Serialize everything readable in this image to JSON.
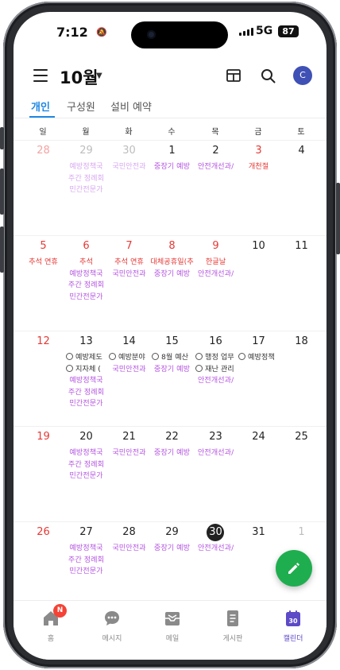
{
  "status_bar": {
    "time": "7:12",
    "network": "5G",
    "battery": "87"
  },
  "header": {
    "month": "10월",
    "avatar_initial": "C"
  },
  "tabs": [
    {
      "label": "개인",
      "active": true
    },
    {
      "label": "구성원",
      "active": false
    },
    {
      "label": "설비 예약",
      "active": false
    }
  ],
  "weekdays": [
    "일",
    "월",
    "화",
    "수",
    "목",
    "금",
    "토"
  ],
  "weeks": [
    {
      "days": [
        {
          "num": "28",
          "style": "dim-red",
          "events": []
        },
        {
          "num": "29",
          "style": "dim",
          "events": [
            {
              "text": "예방정책국",
              "style": "faded"
            },
            {
              "text": "주간 정례회",
              "style": "faded"
            },
            {
              "text": "민간전문가",
              "style": "faded"
            }
          ]
        },
        {
          "num": "30",
          "style": "dim",
          "events": [
            {
              "text": "국민안전과",
              "style": "faded"
            }
          ]
        },
        {
          "num": "1",
          "style": "",
          "events": [
            {
              "text": "중장기 예방",
              "style": ""
            }
          ]
        },
        {
          "num": "2",
          "style": "",
          "events": [
            {
              "text": "안전개선과/",
              "style": ""
            }
          ]
        },
        {
          "num": "3",
          "style": "red",
          "events": [
            {
              "text": "개천절",
              "style": "red"
            }
          ]
        },
        {
          "num": "4",
          "style": "",
          "events": []
        }
      ]
    },
    {
      "days": [
        {
          "num": "5",
          "style": "red",
          "events": [
            {
              "text": "추석 연휴",
              "style": "red"
            }
          ]
        },
        {
          "num": "6",
          "style": "red",
          "events": [
            {
              "text": "추석",
              "style": "red"
            },
            {
              "text": "예방정책국",
              "style": ""
            },
            {
              "text": "주간 정례회",
              "style": ""
            },
            {
              "text": "민간전문가",
              "style": ""
            }
          ]
        },
        {
          "num": "7",
          "style": "red",
          "events": [
            {
              "text": "추석 연휴",
              "style": "red"
            },
            {
              "text": "국민안전과",
              "style": ""
            }
          ]
        },
        {
          "num": "8",
          "style": "red",
          "events": [
            {
              "text": "대체공휴일(추",
              "style": "red"
            },
            {
              "text": "중장기 예방",
              "style": ""
            }
          ]
        },
        {
          "num": "9",
          "style": "red",
          "events": [
            {
              "text": "한글날",
              "style": "red"
            },
            {
              "text": "안전개선과/",
              "style": ""
            }
          ]
        },
        {
          "num": "10",
          "style": "",
          "events": []
        },
        {
          "num": "11",
          "style": "",
          "events": []
        }
      ]
    },
    {
      "days": [
        {
          "num": "12",
          "style": "red",
          "events": []
        },
        {
          "num": "13",
          "style": "",
          "events": [
            {
              "text": "예방제도",
              "style": "task"
            },
            {
              "text": "지자체 (",
              "style": "task"
            },
            {
              "text": "예방정책국",
              "style": ""
            },
            {
              "text": "주간 정례회",
              "style": ""
            },
            {
              "text": "민간전문가",
              "style": ""
            }
          ]
        },
        {
          "num": "14",
          "style": "",
          "events": [
            {
              "text": "예방분야",
              "style": "task"
            },
            {
              "text": "국민안전과",
              "style": ""
            }
          ]
        },
        {
          "num": "15",
          "style": "",
          "events": [
            {
              "text": "8월 예산",
              "style": "task"
            },
            {
              "text": "중장기 예방",
              "style": ""
            }
          ]
        },
        {
          "num": "16",
          "style": "",
          "events": [
            {
              "text": "행정 업무",
              "style": "task"
            },
            {
              "text": "재난 관리",
              "style": "task"
            },
            {
              "text": "안전개선과/",
              "style": ""
            }
          ]
        },
        {
          "num": "17",
          "style": "",
          "events": [
            {
              "text": "예방정책",
              "style": "task"
            }
          ]
        },
        {
          "num": "18",
          "style": "",
          "events": []
        }
      ]
    },
    {
      "days": [
        {
          "num": "19",
          "style": "red",
          "events": []
        },
        {
          "num": "20",
          "style": "",
          "events": [
            {
              "text": "예방정책국",
              "style": ""
            },
            {
              "text": "주간 정례회",
              "style": ""
            },
            {
              "text": "민간전문가",
              "style": ""
            }
          ]
        },
        {
          "num": "21",
          "style": "",
          "events": [
            {
              "text": "국민안전과",
              "style": ""
            }
          ]
        },
        {
          "num": "22",
          "style": "",
          "events": [
            {
              "text": "중장기 예방",
              "style": ""
            }
          ]
        },
        {
          "num": "23",
          "style": "",
          "events": [
            {
              "text": "안전개선과/",
              "style": ""
            }
          ]
        },
        {
          "num": "24",
          "style": "",
          "events": []
        },
        {
          "num": "25",
          "style": "",
          "events": []
        }
      ]
    },
    {
      "days": [
        {
          "num": "26",
          "style": "red",
          "events": []
        },
        {
          "num": "27",
          "style": "",
          "events": [
            {
              "text": "예방정책국",
              "style": ""
            },
            {
              "text": "주간 정례회",
              "style": ""
            },
            {
              "text": "민간전문가",
              "style": ""
            }
          ]
        },
        {
          "num": "28",
          "style": "",
          "events": [
            {
              "text": "국민안전과",
              "style": ""
            }
          ]
        },
        {
          "num": "29",
          "style": "",
          "events": [
            {
              "text": "중장기 예방",
              "style": ""
            }
          ]
        },
        {
          "num": "30",
          "style": "today",
          "events": [
            {
              "text": "안전개선과/",
              "style": ""
            }
          ]
        },
        {
          "num": "31",
          "style": "",
          "events": []
        },
        {
          "num": "1",
          "style": "dim",
          "events": []
        }
      ]
    }
  ],
  "bottom_nav": [
    {
      "label": "홈",
      "icon": "home-icon",
      "badge": "N",
      "active": false
    },
    {
      "label": "메시지",
      "icon": "message-icon",
      "active": false
    },
    {
      "label": "메일",
      "icon": "mail-icon",
      "active": false
    },
    {
      "label": "게시판",
      "icon": "board-icon",
      "active": false
    },
    {
      "label": "캘린더",
      "icon": "calendar-icon",
      "icon_text": "30",
      "active": true
    }
  ],
  "colors": {
    "accent": "#1e88e5",
    "event": "#b455e0",
    "holiday": "#e53935",
    "fab": "#1fae4f",
    "nav_active": "#5c4ac7"
  }
}
